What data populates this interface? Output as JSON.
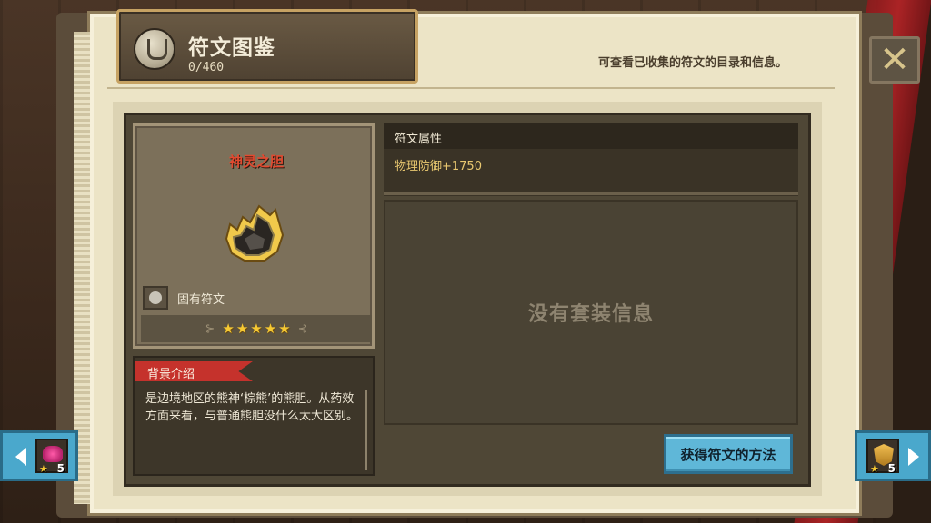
{
  "header": {
    "title": "符文图鉴",
    "count": "0/460",
    "description": "可查看已收集的符文的目录和信息。"
  },
  "rune": {
    "name": "神灵之胆",
    "type_label": "固有符文",
    "stars": 5
  },
  "background": {
    "tag": "背景介绍",
    "text": "是边境地区的熊神‘棕熊’的熊胆。从药效方面来看，与普通熊胆没什么太大区别。"
  },
  "attributes": {
    "title": "符文属性",
    "value": "物理防御+1750"
  },
  "set_info": {
    "empty_text": "没有套装信息"
  },
  "buttons": {
    "acquire": "获得符文的方法"
  },
  "nav": {
    "prev_stars": "5",
    "next_stars": "5"
  },
  "colors": {
    "rune_name": "#e24a30",
    "attr_value": "#e9c870",
    "accent_button": "#5fb7d8",
    "tag_red": "#c5322c",
    "star": "#f6c933"
  },
  "icons": {
    "title": "rune-book-icon",
    "close": "close-icon",
    "rune_type": "stone-icon",
    "star": "star-icon",
    "prev": "arrow-left-icon",
    "next": "arrow-right-icon"
  }
}
